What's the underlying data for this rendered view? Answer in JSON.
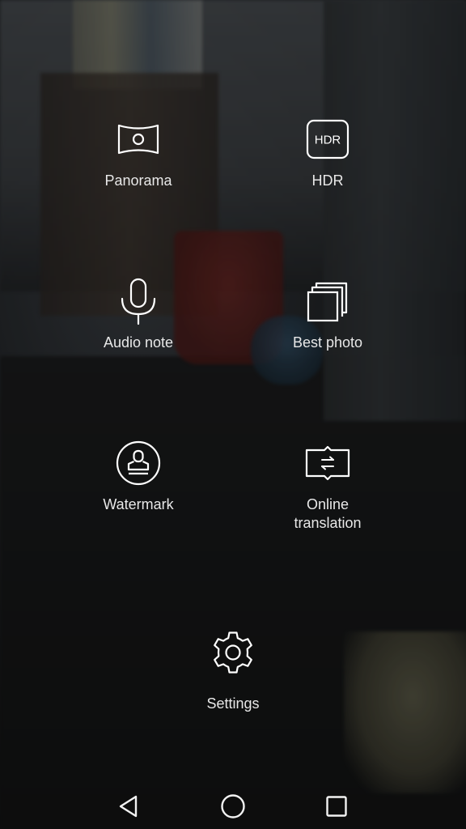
{
  "menu": {
    "items": [
      {
        "label": "Panorama",
        "icon": "panorama-icon"
      },
      {
        "label": "HDR",
        "icon": "hdr-icon",
        "icon_text": "HDR"
      },
      {
        "label": "Audio note",
        "icon": "microphone-icon"
      },
      {
        "label": "Best photo",
        "icon": "stacked-photos-icon"
      },
      {
        "label": "Watermark",
        "icon": "stamp-icon"
      },
      {
        "label": "Online\ntranslation",
        "icon": "book-translate-icon"
      }
    ],
    "settings": {
      "label": "Settings",
      "icon": "gear-icon"
    }
  },
  "navbar": {
    "back_icon": "back-triangle-icon",
    "home_icon": "home-circle-icon",
    "recent_icon": "recent-square-icon"
  },
  "colors": {
    "icon_stroke": "#ffffff",
    "label_text": "#e8e8e8"
  }
}
